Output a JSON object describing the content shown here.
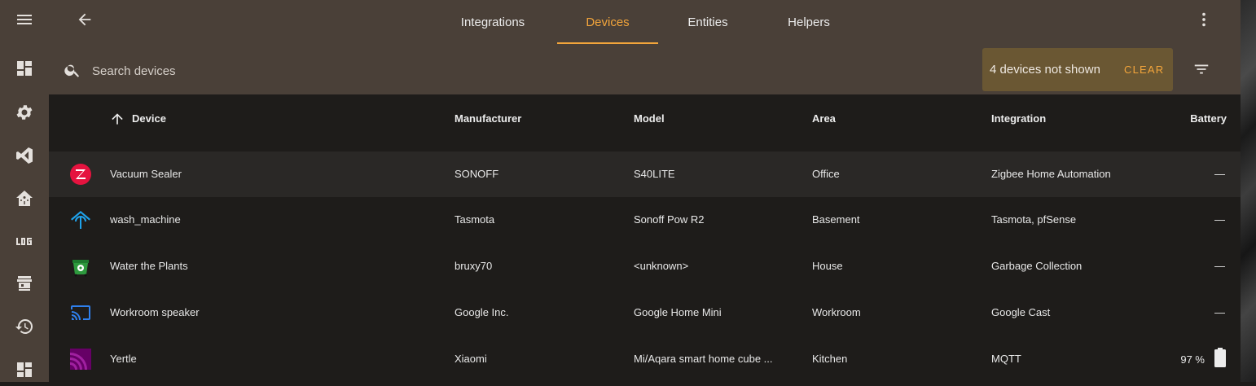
{
  "tabs": [
    "Integrations",
    "Devices",
    "Entities",
    "Helpers"
  ],
  "active_tab": "Devices",
  "search": {
    "placeholder": "Search devices"
  },
  "filter": {
    "text": "4 devices not shown",
    "clear_label": "CLEAR"
  },
  "table": {
    "columns": [
      "Device",
      "Manufacturer",
      "Model",
      "Area",
      "Integration",
      "Battery"
    ],
    "sort": "Device ascending",
    "rows": [
      {
        "icon": "zigbee-icon",
        "device": "Vacuum Sealer",
        "manufacturer": "SONOFF",
        "model": "S40LITE",
        "area": "Office",
        "integration": "Zigbee Home Automation",
        "battery": "—"
      },
      {
        "icon": "tasmota-icon",
        "device": "wash_machine",
        "manufacturer": "Tasmota",
        "model": "Sonoff Pow R2",
        "area": "Basement",
        "integration": "Tasmota, pfSense",
        "battery": "—"
      },
      {
        "icon": "garbage-bin-icon",
        "device": "Water the Plants",
        "manufacturer": "bruxy70",
        "model": "<unknown>",
        "area": "House",
        "integration": "Garbage Collection",
        "battery": "—"
      },
      {
        "icon": "cast-icon",
        "device": "Workroom speaker",
        "manufacturer": "Google Inc.",
        "model": "Google Home Mini",
        "area": "Workroom",
        "integration": "Google Cast",
        "battery": "—"
      },
      {
        "icon": "mqtt-icon",
        "device": "Yertle",
        "manufacturer": "Xiaomi",
        "model": "Mi/Aqara smart home cube ...",
        "area": "Kitchen",
        "integration": "MQTT",
        "battery": "97 %"
      }
    ]
  },
  "sidebar": {
    "items": [
      "menu-icon",
      "dashboard-icon",
      "settings-icon",
      "vscode-icon",
      "home-assistant-icon",
      "log-icon",
      "hacs-icon",
      "history-icon",
      "dashboard-icon"
    ]
  },
  "colors": {
    "accent": "#f3a53b",
    "toolbar": "#4a4038",
    "table_bg": "#1e1c1a",
    "filter_chip": "#6a5733"
  }
}
